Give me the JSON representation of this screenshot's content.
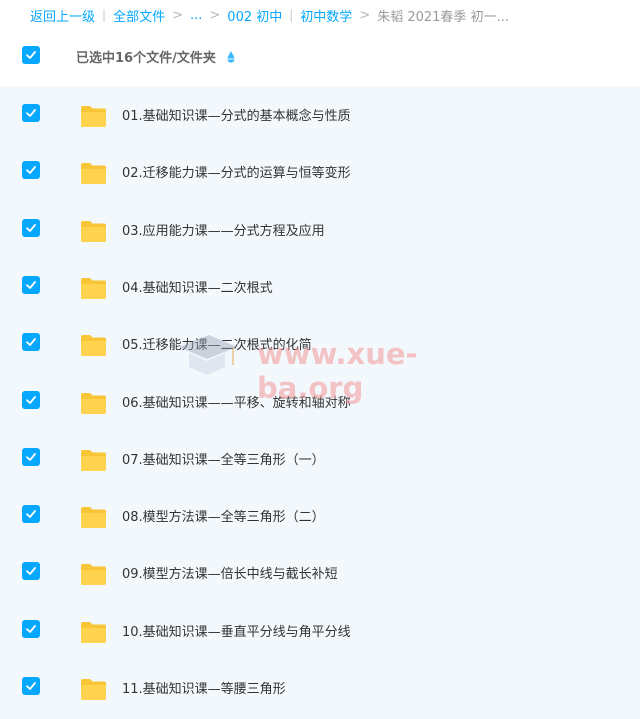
{
  "breadcrumb": {
    "back": "返回上一级",
    "items": [
      {
        "label": "全部文件"
      },
      {
        "label": "..."
      },
      {
        "label": "002 初中"
      },
      {
        "label": "初中数学"
      },
      {
        "label": "朱韬 2021春季 初一..."
      }
    ]
  },
  "selection": {
    "label": "已选中16个文件/文件夹"
  },
  "colors": {
    "accent": "#06a7ff",
    "folder": "#ffd24d",
    "list_bg": "#f3f8fd"
  },
  "files": [
    {
      "name": "01.基础知识课—分式的基本概念与性质",
      "checked": true
    },
    {
      "name": "02.迁移能力课—分式的运算与恒等变形",
      "checked": true
    },
    {
      "name": "03.应用能力课——分式方程及应用",
      "checked": true
    },
    {
      "name": "04.基础知识课—二次根式",
      "checked": true
    },
    {
      "name": "05.迁移能力课—二次根式的化简",
      "checked": true
    },
    {
      "name": "06.基础知识课——平移、旋转和轴对称",
      "checked": true
    },
    {
      "name": "07.基础知识课—全等三角形（一）",
      "checked": true
    },
    {
      "name": "08.模型方法课—全等三角形（二）",
      "checked": true
    },
    {
      "name": "09.模型方法课—倍长中线与截长补短",
      "checked": true
    },
    {
      "name": "10.基础知识课—垂直平分线与角平分线",
      "checked": true
    },
    {
      "name": "11.基础知识课—等腰三角形",
      "checked": true
    }
  ],
  "watermark": {
    "text": "www.xue-ba.org"
  }
}
